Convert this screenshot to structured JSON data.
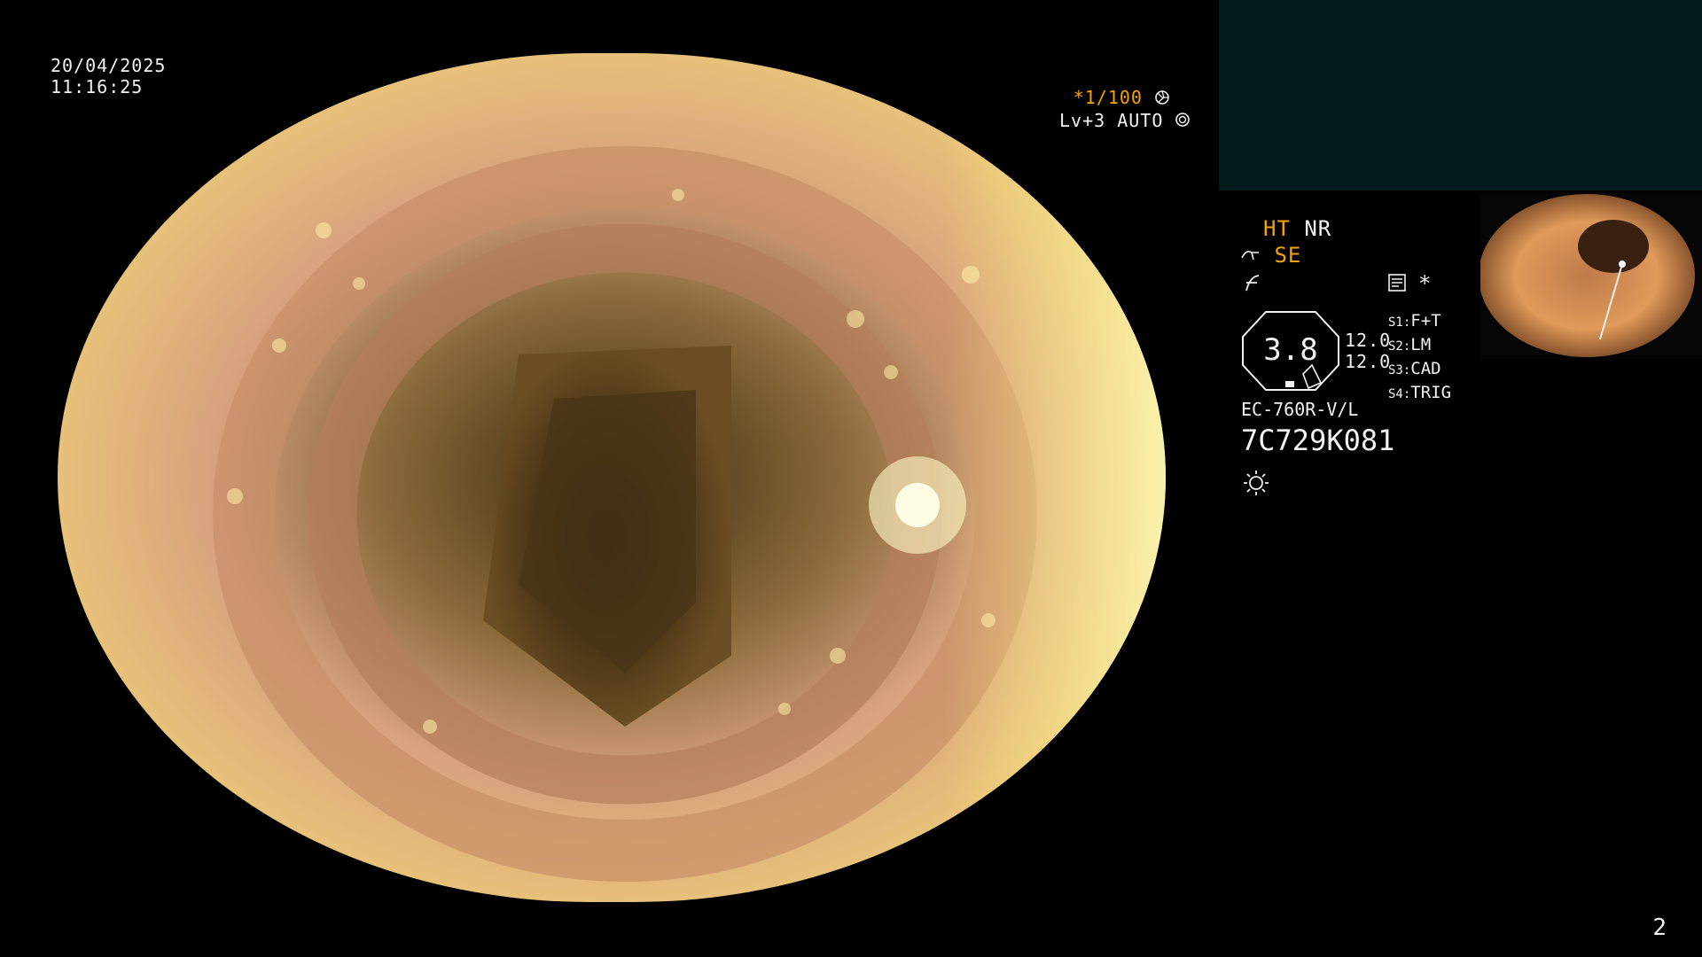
{
  "datetime": {
    "date": "20/04/2025",
    "time": "11:16:25"
  },
  "exposure": {
    "shutter": "*1/100",
    "shutter_icon": "aperture-icon",
    "level": "Lv+3",
    "mode": "AUTO",
    "mode_icon": "iris-icon"
  },
  "panel": {
    "ht_label": "HT",
    "nr_label": "NR",
    "se_label": "SE",
    "se_icon": "scope-tip-icon",
    "f_icon": "f-curve-icon",
    "memory_icon": "memory-card-icon",
    "star_label": "*",
    "speed_value": "3.8",
    "value_1": "12.0",
    "value_2": "12.0",
    "switches": [
      {
        "key": "S1:",
        "value": "F+T"
      },
      {
        "key": "S2:",
        "value": "LM"
      },
      {
        "key": "S3:",
        "value": "CAD"
      },
      {
        "key": "S4:",
        "value": "TRIG"
      }
    ],
    "scope_model": "EC-760R-V/L",
    "scope_serial": "7C729K081",
    "light_icon": "sun-icon"
  },
  "page_number": "2",
  "colors": {
    "accent": "#f5a300",
    "panel_box": "#021c1c"
  }
}
